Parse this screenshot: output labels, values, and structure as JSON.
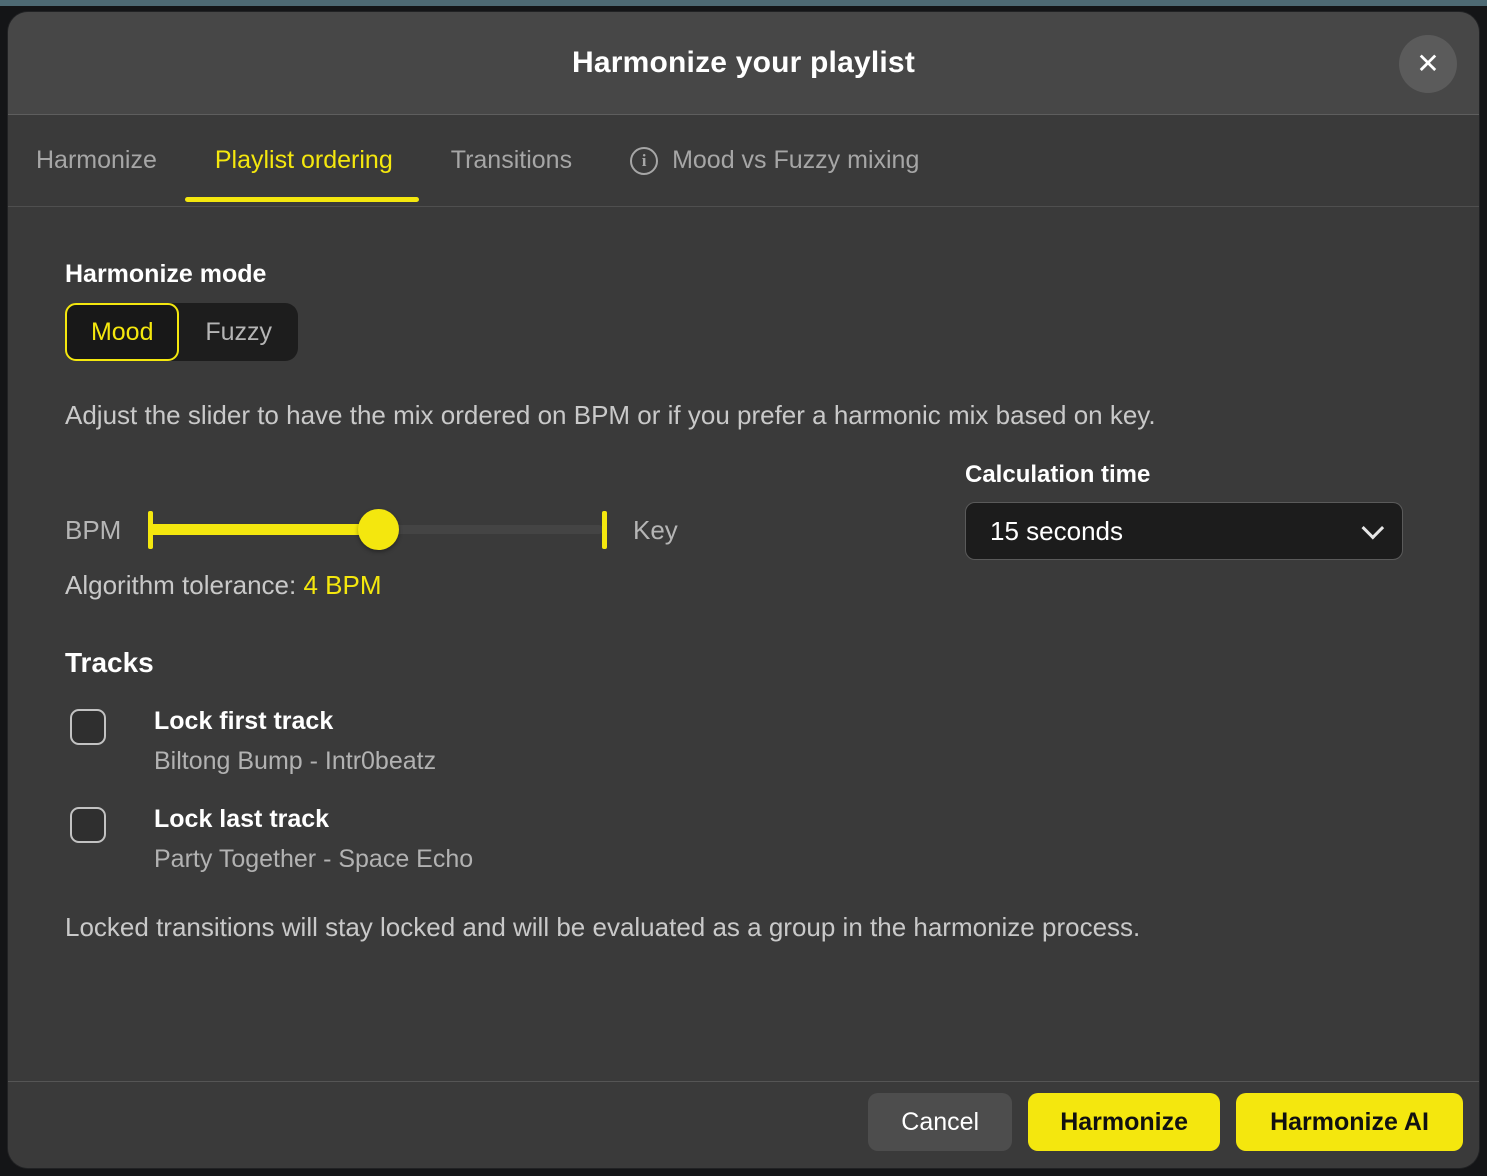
{
  "modal": {
    "title": "Harmonize your playlist",
    "close_icon": "✕"
  },
  "tabs": [
    {
      "label": "Harmonize",
      "active": false
    },
    {
      "label": "Playlist ordering",
      "active": true
    },
    {
      "label": "Transitions",
      "active": false
    },
    {
      "label": "Mood vs Fuzzy mixing",
      "active": false,
      "icon": "info-icon",
      "icon_glyph": "i"
    }
  ],
  "harmonize_mode": {
    "heading": "Harmonize mode",
    "options": [
      {
        "label": "Mood",
        "selected": true
      },
      {
        "label": "Fuzzy",
        "selected": false
      }
    ]
  },
  "description": "Adjust the slider to have the mix ordered on BPM or if you prefer a harmonic mix based on key.",
  "slider": {
    "left_label": "BPM",
    "right_label": "Key",
    "value_percent": 50,
    "tolerance_label": "Algorithm tolerance:",
    "tolerance_value": "4 BPM"
  },
  "calculation_time": {
    "label": "Calculation time",
    "selected_value": "15 seconds"
  },
  "tracks": {
    "heading": "Tracks",
    "items": [
      {
        "label": "Lock first track",
        "track": "Biltong Bump - Intr0beatz",
        "checked": false
      },
      {
        "label": "Lock last track",
        "track": "Party Together - Space Echo",
        "checked": false
      }
    ]
  },
  "note": "Locked transitions will stay locked and will be evaluated as a group in the harmonize process.",
  "footer": {
    "cancel_label": "Cancel",
    "harmonize_label": "Harmonize",
    "harmonize_ai_label": "Harmonize AI"
  },
  "colors": {
    "accent_yellow": "#f4e70e",
    "modal_body": "#3a3a3a",
    "modal_header": "#474747",
    "control_dark": "#1c1c1c",
    "text_muted": "#c9c9c9",
    "top_strip": "#4e6a74"
  }
}
